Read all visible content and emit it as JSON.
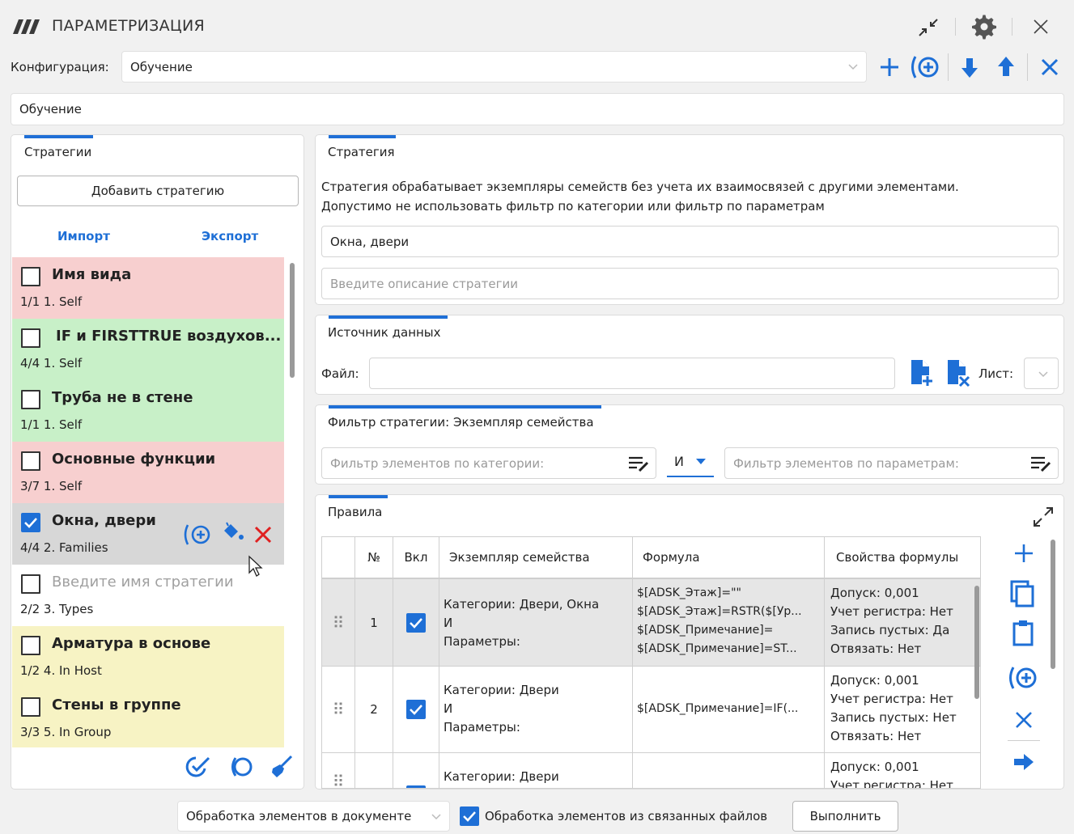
{
  "window": {
    "title": "ПАРАМЕТРИЗАЦИЯ"
  },
  "config": {
    "label": "Конфигурация:",
    "value": "Обучение",
    "name_value": "Обучение"
  },
  "strategies_panel": {
    "title": "Стратегии",
    "add_button": "Добавить стратегию",
    "import_label": "Импорт",
    "export_label": "Экспорт",
    "items": [
      {
        "name": "Имя вида",
        "count": "1/1",
        "type": "1. Self",
        "checked": false,
        "bg": "#f7cfcf"
      },
      {
        "name": "IF и FIRSTTRUE воздухов...",
        "count": "4/4",
        "type": "1. Self",
        "checked": false,
        "bg": "#c8f0c8"
      },
      {
        "name": "Труба не в стене",
        "count": "1/1",
        "type": "1. Self",
        "checked": false,
        "bg": "#c8f0c8"
      },
      {
        "name": "Основные функции",
        "count": "3/7",
        "type": "1. Self",
        "checked": false,
        "bg": "#f7cfcf"
      },
      {
        "name": "Окна, двери",
        "count": "4/4",
        "type": "2. Families",
        "checked": true,
        "bg": "#d7d7d7"
      },
      {
        "name": "Введите имя стратегии",
        "count": "2/2",
        "type": "3. Types",
        "checked": false,
        "bg": "#ffffff"
      },
      {
        "name": "Арматура в основе",
        "count": "1/2",
        "type": "4. In Host",
        "checked": false,
        "bg": "#f7f3c4"
      },
      {
        "name": "Стены в группе",
        "count": "3/3",
        "type": "5. In Group",
        "checked": false,
        "bg": "#f7f3c4"
      }
    ]
  },
  "strategy": {
    "title": "Стратегия",
    "description_line1": "Стратегия обрабатывает экземпляры семейств без учета их взаимосвязей с другими элементами.",
    "description_line2": "Допустимо не использовать фильтр по категории или фильтр по параметрам",
    "name_value": "Окна, двери",
    "desc_placeholder": "Введите описание стратегии"
  },
  "datasource": {
    "title": "Источник данных",
    "file_label": "Файл:",
    "file_value": "",
    "sheet_label": "Лист:"
  },
  "filter": {
    "title": "Фильтр стратегии: Экземпляр семейства",
    "category_placeholder": "Фильтр элементов по категории:",
    "operator": "И",
    "param_placeholder": "Фильтр элементов по параметрам:"
  },
  "rules": {
    "title": "Правила",
    "columns": [
      "№",
      "Вкл",
      "Экземпляр семейства",
      "Формула",
      "Свойства формулы"
    ],
    "rows": [
      {
        "num": "1",
        "enabled": true,
        "instance": [
          "Категории: Двери, Окна",
          "И",
          "Параметры:"
        ],
        "formula": [
          "$[ADSK_Этаж]=\"\"",
          "$[ADSK_Этаж]=RSTR($[Ур...",
          "$[ADSK_Примечание]=",
          "$[ADSK_Примечание]=ST..."
        ],
        "props": [
          "Допуск: 0,001",
          "Учет регистра: Нет",
          "Запись пустых: Да",
          "Отвязать: Нет"
        ]
      },
      {
        "num": "2",
        "enabled": true,
        "instance": [
          "Категории: Двери",
          "И",
          "Параметры:"
        ],
        "formula": [
          "$[ADSK_Примечание]=IF(..."
        ],
        "props": [
          "Допуск: 0,001",
          "Учет регистра: Нет",
          "Запись пустых: Нет",
          "Отвязать: Нет"
        ]
      },
      {
        "num": "",
        "enabled": true,
        "instance": [
          "Категории: Двери"
        ],
        "formula": [],
        "props": [
          "Допуск: 0,001",
          "Учет регистра: Нет"
        ]
      }
    ]
  },
  "bottom": {
    "mode_value": "Обработка элементов в документе",
    "linked_label": "Обработка элементов из связанных файлов",
    "linked_checked": true,
    "run_button": "Выполнить"
  }
}
